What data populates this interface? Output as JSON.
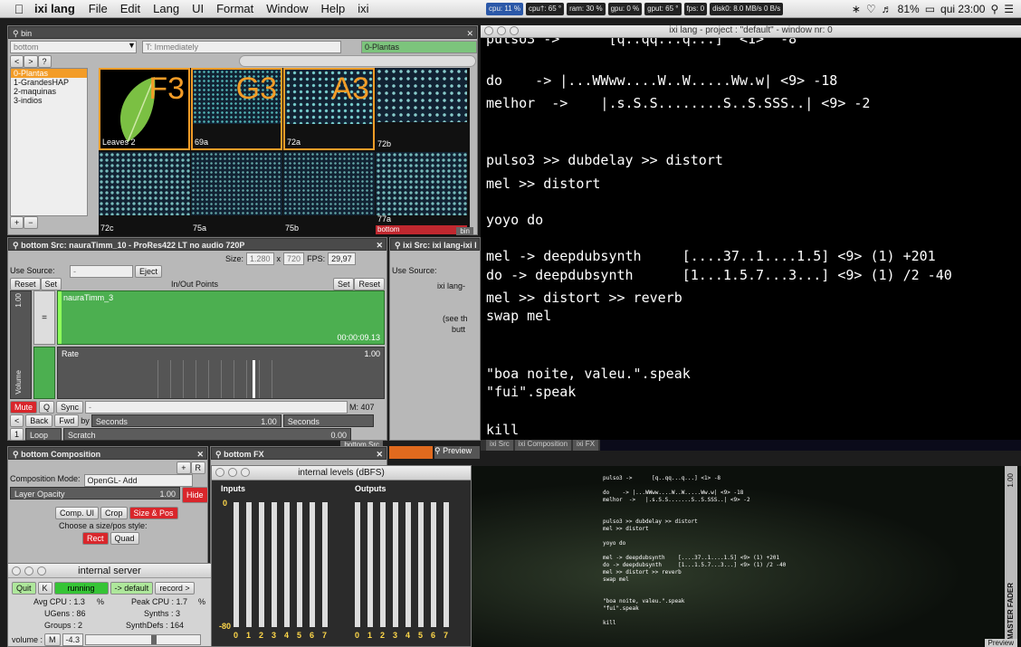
{
  "menubar": {
    "app": "ixi lang",
    "items": [
      "File",
      "Edit",
      "Lang",
      "UI",
      "Format",
      "Window",
      "Help",
      "ixi"
    ],
    "stats": [
      "cpu: 11 %",
      "cpu†: 65 °",
      "ram: 30 %",
      "gpu: 0 %",
      "gput: 65 °",
      "fps: 0",
      "disk0: 8.0 MB/s 0 B/s"
    ],
    "battery": "81%",
    "clock": "qui 23:00"
  },
  "bin": {
    "title": "bin",
    "layer_select": "bottom",
    "transition": "T: Immediately",
    "folder_select": "0-Plantas",
    "folders": [
      "0-Plantas",
      "1-GrandesHAP",
      "2-maquinas",
      "3-indios"
    ],
    "thumbs": [
      {
        "label": "Leaves 2",
        "key": "F3"
      },
      {
        "label": "69a",
        "key": "G3"
      },
      {
        "label": "72a",
        "key": "A3"
      },
      {
        "label": "72b",
        "key": ""
      },
      {
        "label": "72c",
        "key": ""
      },
      {
        "label": "75a",
        "key": ""
      },
      {
        "label": "75b",
        "key": ""
      },
      {
        "label": "77a",
        "key": ""
      }
    ],
    "bottom_tag": "bottom",
    "tab": "bin"
  },
  "source": {
    "title": "bottom Src: nauraTimm_10 - ProRes422 LT no audio 720P",
    "size_label": "Size:",
    "w": "1.280",
    "h": "720",
    "fps_label": "FPS:",
    "fps": "29,97",
    "use_source": "Use Source:",
    "use_source_value": "-",
    "eject": "Eject",
    "reset": "Reset",
    "set": "Set",
    "inout": "In/Out Points",
    "clip": "nauraTimm_3",
    "timecode": "00:00:09.13",
    "rate_label": "Rate",
    "rate": "1.00",
    "left_val": "1.00",
    "volume": "Volume",
    "mute": "Mute",
    "q": "Q",
    "sync": "Sync",
    "sync_val": "-",
    "m": "M: 407",
    "back": "Back",
    "fwd": "Fwd",
    "by": "by",
    "seconds": "Seconds",
    "seconds_val": "1.00",
    "seconds2": "Seconds",
    "loop": "Loop",
    "scratch": "Scratch",
    "scratch_val": "0.00",
    "tab": "bottom Src"
  },
  "ixisrc": {
    "title": "ixi Src: ixi lang-ixi l",
    "use_source": "Use Source:",
    "line1": "ixi lang-",
    "line2": "(see th",
    "line3": "butt"
  },
  "terminal_title": "ixi lang  -  project : \"default\"  -  window nr: 0",
  "terminal_lines": [
    "pulso3 ->      [q..qq...q...]  <1>  -8",
    "",
    "do    -> |...WWww....W..W.....Ww.w| <9> -18",
    "melhor  ->    |.s.S.S........S..S.SSS..| <9> -2",
    "",
    "",
    "pulso3 >> dubdelay >> distort",
    "mel >> distort",
    "",
    "yoyo do",
    "",
    "mel -> deepdubsynth     [....37..1....1.5] <9> (1) +201",
    "do -> deepdubsynth      [1...1.5.7...3...] <9> (1) /2 -40",
    "mel >> distort >> reverb",
    "swap mel",
    "",
    "",
    "\"boa noite, valeu.\".speak",
    "\"fui\".speak",
    "",
    "kill"
  ],
  "bottom_tabs": [
    "ixi Src",
    "ixi Composition",
    "ixi FX"
  ],
  "composition": {
    "title": "bottom Composition",
    "mode_label": "Composition Mode:",
    "mode": "OpenGL- Add",
    "opacity_label": "Layer Opacity",
    "opacity": "1.00",
    "hide": "Hide",
    "comp_ui": "Comp. UI",
    "crop": "Crop",
    "size_pos": "Size & Pos",
    "choose": "Choose a size/pos style:",
    "rect": "Rect",
    "quad": "Quad",
    "plus": "+",
    "r": "R"
  },
  "fx": {
    "title": "bottom FX"
  },
  "preview_tab": "Preview",
  "levels": {
    "title": "internal levels (dBFS)",
    "inputs": "Inputs",
    "outputs": "Outputs",
    "top": "0",
    "bottom": "-80",
    "channels": [
      "0",
      "1",
      "2",
      "3",
      "4",
      "5",
      "6",
      "7"
    ]
  },
  "server": {
    "title": "internal server",
    "quit": "Quit",
    "k": "K",
    "running": "running",
    "default": "-> default",
    "record": "record >",
    "avg_cpu": "Avg CPU : 1.3",
    "pct": "%",
    "peak_cpu": "Peak CPU : 1.7",
    "pct2": "%",
    "ugens": "UGens : 86",
    "synths": "Synths : 3",
    "groups": "Groups : 2",
    "synthdefs": "SynthDefs : 164",
    "volume": "volume :",
    "m": "M",
    "vol_val": "-4.3"
  },
  "preview_lines": [
    "pulso3 ->      [q..qq...q...] <1> -8",
    "",
    "do    -> |...WWww....W..W.....Ww.w| <9> -18",
    "melhor  ->   |.s.S.S.......S..S.SSS..| <9> -2",
    "",
    "",
    "pulso3 >> dubdelay >> distort",
    "mel >> distort",
    "",
    "yoyo do",
    "",
    "mel -> deepdubsynth    [....37..1....1.5] <9> (1) +201",
    "do -> deepdubsynth     [1...1.5.7...3...] <9> (1) /2 -40",
    "mel >> distort >> reverb",
    "swap mel",
    "",
    "",
    "\"boa noite, valeu.\".speak",
    "\"fui\".speak",
    "",
    "kill"
  ],
  "preview_side": "1.00",
  "master_fader": "MASTER FADER",
  "preview_bottom": "Preview"
}
